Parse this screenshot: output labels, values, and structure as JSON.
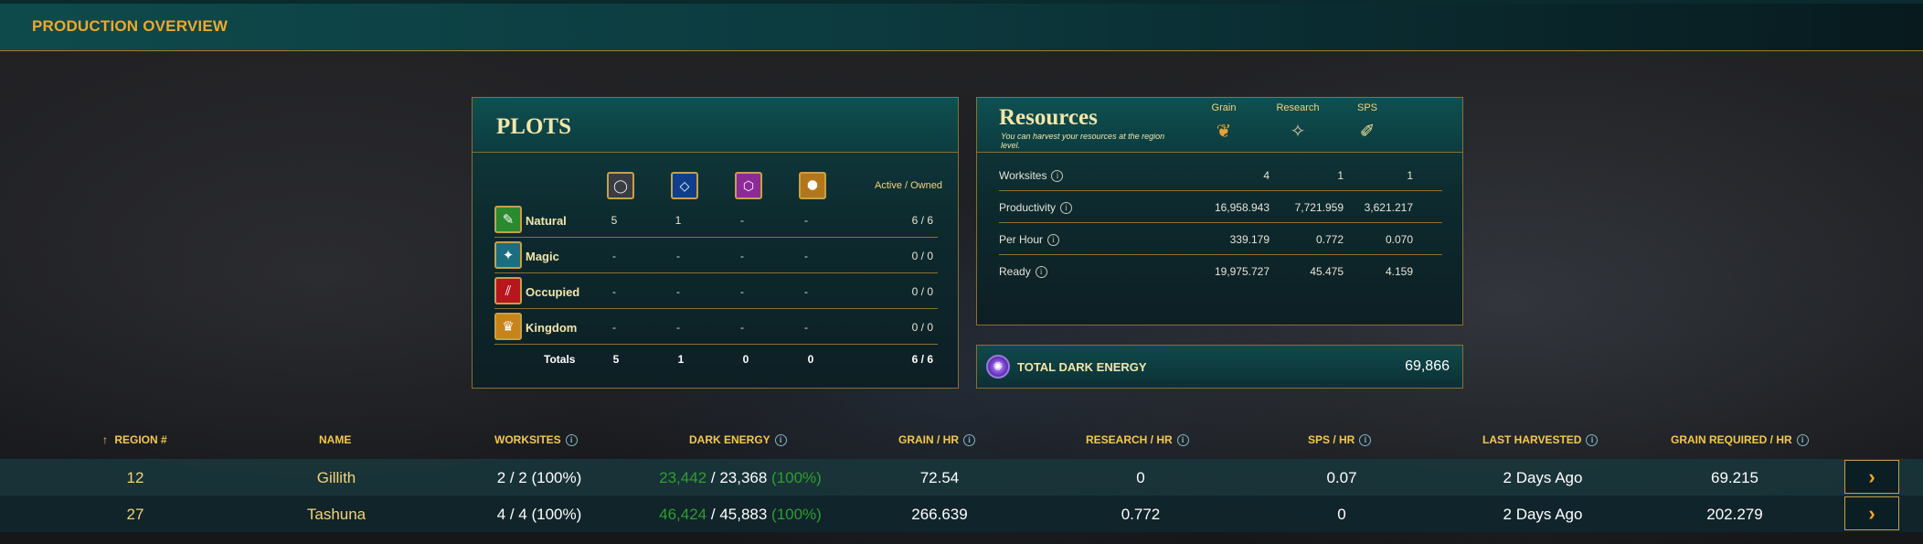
{
  "topbar": {
    "title": "PRODUCTION OVERVIEW"
  },
  "plots": {
    "title": "PLOTS",
    "active_owned_label": "Active / Owned",
    "type_icons": [
      "circle-type-icon",
      "diamond-type-icon",
      "hexagon-type-icon",
      "octagon-type-icon"
    ],
    "rows": [
      {
        "label": "Natural",
        "icon": "natural-icon",
        "values": [
          "5",
          "1",
          "-",
          "-"
        ],
        "active_owned": "6 / 6"
      },
      {
        "label": "Magic",
        "icon": "magic-icon",
        "values": [
          "-",
          "-",
          "-",
          "-"
        ],
        "active_owned": "0 / 0"
      },
      {
        "label": "Occupied",
        "icon": "occupied-icon",
        "values": [
          "-",
          "-",
          "-",
          "-"
        ],
        "active_owned": "0 / 0"
      },
      {
        "label": "Kingdom",
        "icon": "kingdom-icon",
        "values": [
          "-",
          "-",
          "-",
          "-"
        ],
        "active_owned": "0 / 0"
      }
    ],
    "totals": {
      "label": "Totals",
      "values": [
        "5",
        "1",
        "0",
        "0"
      ],
      "active_owned": "6 / 6"
    }
  },
  "resources": {
    "title": "Resources",
    "subtitle": "You can harvest your resources at the region level.",
    "columns": [
      {
        "label": "Grain",
        "icon": "grain-icon"
      },
      {
        "label": "Research",
        "icon": "research-icon"
      },
      {
        "label": "SPS",
        "icon": "sps-icon"
      }
    ],
    "rows": [
      {
        "label": "Worksites",
        "values": [
          "4",
          "1",
          "1"
        ]
      },
      {
        "label": "Productivity",
        "values": [
          "16,958.943",
          "7,721.959",
          "3,621.217"
        ]
      },
      {
        "label": "Per Hour",
        "values": [
          "339.179",
          "0.772",
          "0.070"
        ]
      },
      {
        "label": "Ready",
        "values": [
          "19,975.727",
          "45.475",
          "4.159"
        ]
      }
    ]
  },
  "dark_energy": {
    "label": "TOTAL DARK ENERGY",
    "value": "69,866",
    "icon": "dark-energy-icon"
  },
  "table": {
    "sort_arrow": "↑",
    "headers": {
      "region": "REGION #",
      "name": "NAME",
      "worksites": "WORKSITES",
      "dark_energy": "DARK ENERGY",
      "grain_hr": "GRAIN / HR",
      "research_hr": "RESEARCH / HR",
      "sps_hr": "SPS / HR",
      "last_harvested": "LAST HARVESTED",
      "grain_required": "GRAIN REQUIRED / HR"
    },
    "rows": [
      {
        "region": "12",
        "name": "Gillith",
        "worksites": "2 / 2 (100%)",
        "de_current": "23,442",
        "de_sep": " / ",
        "de_total": "23,368",
        "de_pct": " (100%)",
        "grain_hr": "72.54",
        "research_hr": "0",
        "sps_hr": "0.07",
        "last_harvested": "2 Days Ago",
        "grain_required": "69.215"
      },
      {
        "region": "27",
        "name": "Tashuna",
        "worksites": "4 / 4 (100%)",
        "de_current": "46,424",
        "de_sep": " / ",
        "de_total": "45,883",
        "de_pct": " (100%)",
        "grain_hr": "266.639",
        "research_hr": "0.772",
        "sps_hr": "0",
        "last_harvested": "2 Days Ago",
        "grain_required": "202.279"
      }
    ]
  },
  "colors": {
    "accent": "#f0a829",
    "gold_text": "#f3d27a",
    "teal": "#0f4a4c",
    "border": "#8a7030",
    "green": "#2f9e2f"
  }
}
